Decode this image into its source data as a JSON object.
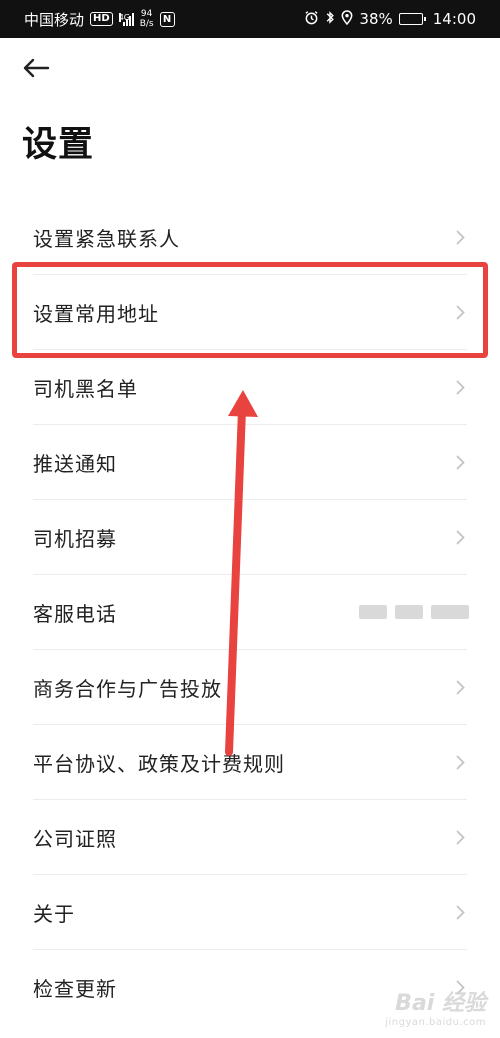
{
  "status_bar": {
    "carrier": "中国移动",
    "hd": "HD",
    "network_type": "4G",
    "speed_value": "94",
    "speed_unit": "B/s",
    "nfc": "N",
    "battery_percent": "38%",
    "battery_level": 0.38,
    "time": "14:00"
  },
  "header": {
    "back_icon": "arrow-left-icon",
    "title": "设置"
  },
  "menu": {
    "items": [
      {
        "label": "设置紧急联系人"
      },
      {
        "label": "设置常用地址"
      },
      {
        "label": "司机黑名单"
      },
      {
        "label": "推送通知"
      },
      {
        "label": "司机招募"
      },
      {
        "label": "客服电话"
      },
      {
        "label": "商务合作与广告投放"
      },
      {
        "label": "平台协议、政策及计费规则"
      },
      {
        "label": "公司证照"
      },
      {
        "label": "关于"
      },
      {
        "label": "检查更新"
      }
    ]
  },
  "annotation": {
    "highlight_color": "#e8433e",
    "highlighted_item": "设置常用地址"
  },
  "watermark": {
    "logo": "Bai 经验",
    "url": "jingyan.baidu.com"
  }
}
